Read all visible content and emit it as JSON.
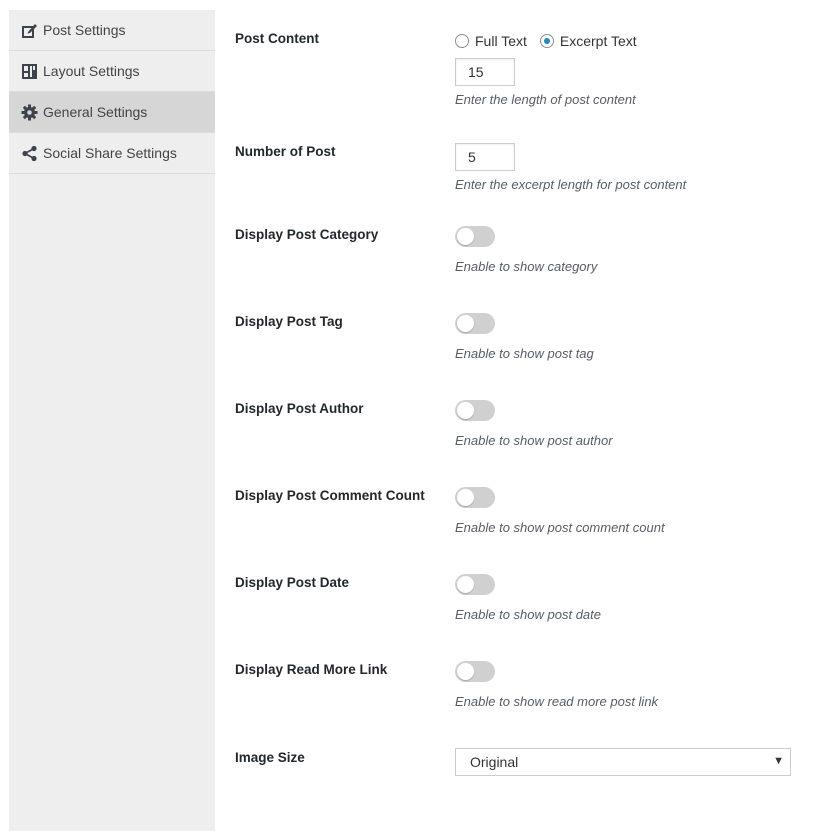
{
  "sidebar": {
    "items": [
      {
        "label": "Post Settings",
        "icon": "edit-icon",
        "active": false
      },
      {
        "label": "Layout Settings",
        "icon": "layout-icon",
        "active": false
      },
      {
        "label": "General Settings",
        "icon": "gear-icon",
        "active": true
      },
      {
        "label": "Social Share Settings",
        "icon": "share-icon",
        "active": false
      }
    ]
  },
  "settings": {
    "post_content": {
      "label": "Post Content",
      "options": [
        "Full Text",
        "Excerpt Text"
      ],
      "selected": "Excerpt Text",
      "value": "15",
      "description": "Enter the length of post content"
    },
    "number_of_post": {
      "label": "Number of Post",
      "value": "5",
      "description": "Enter the excerpt length for post content"
    },
    "toggles": [
      {
        "label": "Display Post Category",
        "description": "Enable to show category",
        "enabled": false
      },
      {
        "label": "Display Post Tag",
        "description": "Enable to show post tag",
        "enabled": false
      },
      {
        "label": "Display Post Author",
        "description": "Enable to show post author",
        "enabled": false
      },
      {
        "label": "Display Post Comment Count",
        "description": "Enable to show post comment count",
        "enabled": false
      },
      {
        "label": "Display Post Date",
        "description": "Enable to show post date",
        "enabled": false
      },
      {
        "label": "Display Read More Link",
        "description": "Enable to show read more post link",
        "enabled": false
      }
    ],
    "image_size": {
      "label": "Image Size",
      "selected": "Original"
    }
  },
  "colors": {
    "sidebar_bg": "#eeeeee",
    "sidebar_active_bg": "#d6d6d6",
    "toggle_off": "#d0d0d0",
    "radio_checked": "#1e8cbe"
  }
}
